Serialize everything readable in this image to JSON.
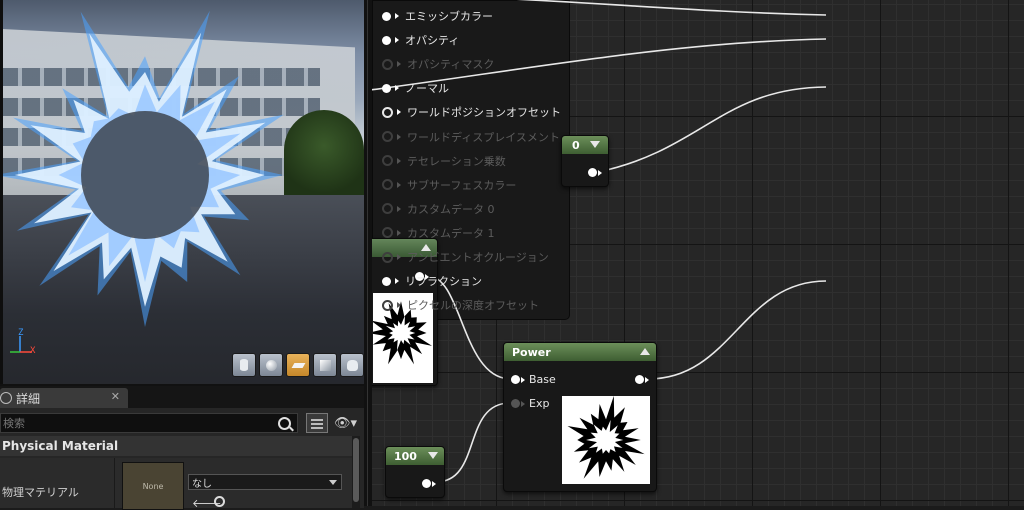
{
  "viewport": {
    "toolbar": [
      "cylinder-preview",
      "sphere-preview",
      "plane-preview",
      "cube-preview",
      "teapot-preview"
    ],
    "active_tool": "plane-preview",
    "axis": {
      "z": "Z",
      "x": "X"
    }
  },
  "details": {
    "tab_label": "詳細",
    "tab_close": "✕",
    "search_placeholder": "検索",
    "section_title": "Physical Material",
    "property_label": "物理マテリアル",
    "thumbnail_text": "None",
    "asset_value": "なし",
    "use_asset_glyph": "🡐"
  },
  "graph": {
    "const_node_value": "0",
    "const100_value": "100",
    "power_node": {
      "title": "Power",
      "input_base": "Base",
      "input_exp": "Exp"
    },
    "result_pins": [
      {
        "label": "エミッシブカラー",
        "state": "connected"
      },
      {
        "label": "オパシティ",
        "state": "connected"
      },
      {
        "label": "オパシティマスク",
        "state": "disabled"
      },
      {
        "label": "ノーマル",
        "state": "connected"
      },
      {
        "label": "ワールドポジションオフセット",
        "state": "open"
      },
      {
        "label": "ワールドディスプレイスメント",
        "state": "disabled"
      },
      {
        "label": "テセレーション乗数",
        "state": "disabled"
      },
      {
        "label": "サブサーフェスカラー",
        "state": "disabled"
      },
      {
        "label": "カスタムデータ 0",
        "state": "disabled"
      },
      {
        "label": "カスタムデータ 1",
        "state": "disabled"
      },
      {
        "label": "アンビエントオクルージョン",
        "state": "disabled"
      },
      {
        "label": "リフラクション",
        "state": "connected"
      },
      {
        "label": "ピクセルの深度オフセット",
        "state": "disabled"
      }
    ]
  },
  "colors": {
    "node_header": "#4e7042",
    "graph_bg": "#262626",
    "burst": "#4aa3ff"
  }
}
